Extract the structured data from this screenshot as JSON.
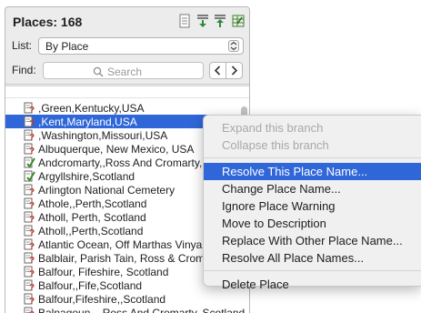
{
  "panel": {
    "title": "Places: 168",
    "list_label": "List:",
    "list_value": "By Place",
    "find_label": "Find:",
    "search_placeholder": "Search"
  },
  "toolbar": {
    "icons": [
      "document-icon",
      "sort-down-icon",
      "sort-up-icon",
      "spreadsheet-icon"
    ]
  },
  "places": [
    {
      "name": ",Green,Kentucky,USA",
      "icon": "warning",
      "selected": false
    },
    {
      "name": ",Kent,Maryland,USA",
      "icon": "warning",
      "selected": true
    },
    {
      "name": ",Washington,Missouri,USA",
      "icon": "warning",
      "selected": false
    },
    {
      "name": "Albuquerque, New Mexico, USA",
      "icon": "warning",
      "selected": false
    },
    {
      "name": "Andcromarty,,Ross And Cromarty,Scotland",
      "icon": "check",
      "selected": false
    },
    {
      "name": "Argyllshire,Scotland",
      "icon": "check",
      "selected": false
    },
    {
      "name": "Arlington National Cemetery",
      "icon": "warning",
      "selected": false
    },
    {
      "name": "Athole,,Perth,Scotland",
      "icon": "warning",
      "selected": false
    },
    {
      "name": "Atholl, Perth, Scotland",
      "icon": "warning",
      "selected": false
    },
    {
      "name": "Atholl,,Perth,Scotland",
      "icon": "warning",
      "selected": false
    },
    {
      "name": "Atlantic Ocean, Off Marthas Vinyard, Massachusetts",
      "icon": "warning",
      "selected": false
    },
    {
      "name": "Balblair, Parish Tain, Ross & Cromarty, Scotland",
      "icon": "warning",
      "selected": false
    },
    {
      "name": "Balfour, Fifeshire, Scotland",
      "icon": "warning",
      "selected": false
    },
    {
      "name": "Balfour,,Fife,Scotland",
      "icon": "warning",
      "selected": false
    },
    {
      "name": "Balfour,Fifeshire,,Scotland",
      "icon": "warning",
      "selected": false
    },
    {
      "name": "Balnagoun, , Ross And Cromarty, Scotland",
      "icon": "warning",
      "selected": false
    }
  ],
  "context_menu": {
    "items": [
      {
        "label": "Expand this branch",
        "state": "disabled"
      },
      {
        "label": "Collapse this branch",
        "state": "disabled"
      },
      {
        "label": "Resolve This Place Name...",
        "state": "highlighted"
      },
      {
        "label": "Change Place Name...",
        "state": "normal"
      },
      {
        "label": "Ignore Place Warning",
        "state": "normal"
      },
      {
        "label": "Move to Description",
        "state": "normal"
      },
      {
        "label": "Replace With Other Place Name...",
        "state": "normal"
      },
      {
        "label": "Resolve All Place Names...",
        "state": "normal"
      },
      {
        "label": "Delete Place",
        "state": "normal"
      }
    ]
  },
  "colors": {
    "selection": "#2f66d8",
    "warning_icon": "#c23a2c",
    "check_icon": "#3f8a2e"
  }
}
